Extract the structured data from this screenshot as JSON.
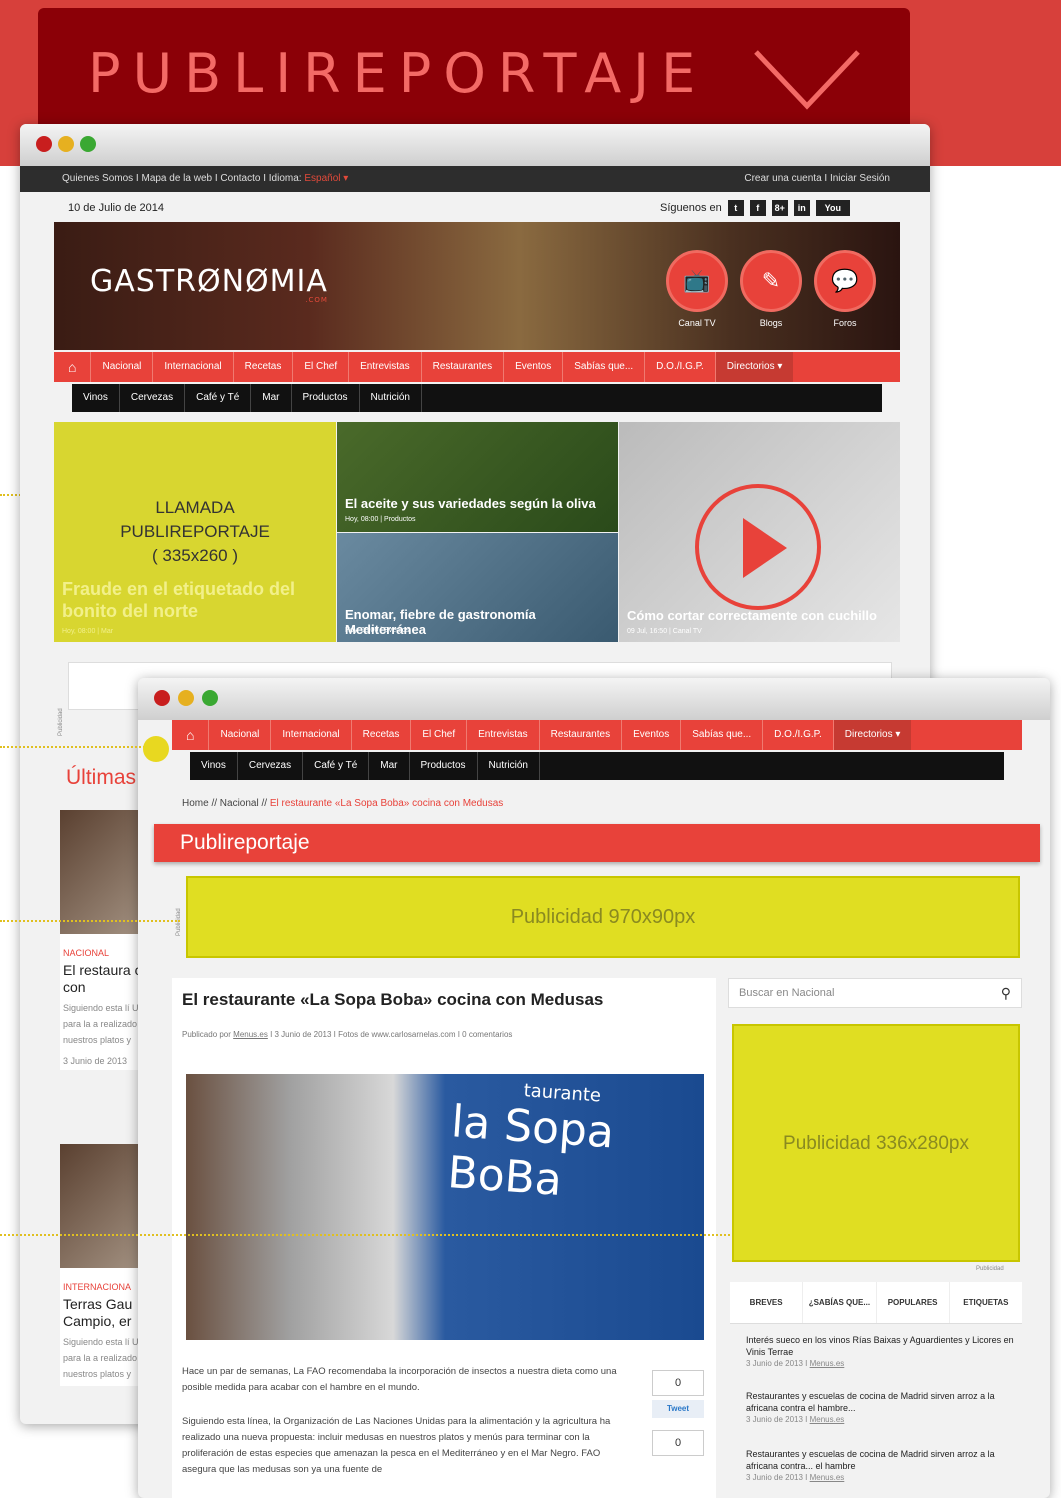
{
  "banner": {
    "title": "PUBLIREPORTAJE"
  },
  "top": {
    "left_links": "Quienes Somos   I   Mapa de la web   I   Contacto   I   Idioma:",
    "lang": "Español ▾",
    "right_links": "Crear una cuenta   I   Iniciar Sesión"
  },
  "date": "10 de Julio de 2014",
  "follow": "Síguenos en",
  "social": [
    "t",
    "f",
    "8+",
    "in",
    "You"
  ],
  "logo": "GASTRØNØMIA",
  "logo_com": ".COM",
  "circles": [
    "Canal TV",
    "Blogs",
    "Foros"
  ],
  "nav": [
    "Nacional",
    "Internacional",
    "Recetas",
    "El Chef",
    "Entrevistas",
    "Restaurantes",
    "Eventos",
    "Sabías que...",
    "D.O./I.G.P.",
    "Directorios ▾"
  ],
  "subnav": [
    "Vinos",
    "Cervezas",
    "Café y Té",
    "Mar",
    "Productos",
    "Nutrición"
  ],
  "tiles": {
    "call": "LLAMADA\nPUBLIREPORTAJE\n( 335x260 )",
    "t1_title": "Fraude en el etiquetado del bonito del norte",
    "t1_meta": "Hoy, 08:00 | Mar",
    "t2_title": "El aceite y sus variedades según la oliva",
    "t2_meta": "Hoy, 08:00 | Productos",
    "t3_title": "Enomar, fiebre de gastronomía Mediterránea",
    "t3_meta": "Hoy, 08:00 | Eventos",
    "t4_title": "Cómo cortar correctamente con cuchillo",
    "t4_meta": "09 Jul, 16:50 | Canal TV"
  },
  "ad_label": "Publicidad",
  "ultimas": "Últimas",
  "cards": [
    {
      "cat": "NACIONAL",
      "head": "El restaura cocina con",
      "text": "Siguiendo esta lí Unidas para la a realizado una nu nuestros platos y",
      "date": "3 Junio de 2013"
    },
    {
      "cat": "INTERNACIONA",
      "head": "Terras Gau Campio, er",
      "text": "Siguiendo esta lí Unidas para la a realizado una nu nuestros platos y",
      "date": ""
    }
  ],
  "breadcrumb": {
    "a": "Home  //  Nacional  //  ",
    "cur": "El restaurante «La Sopa Boba» cocina con Medusas"
  },
  "section": "Publireportaje",
  "ad970": "Publicidad 970x90px",
  "article": {
    "title": "El restaurante «La Sopa Boba» cocina con Medusas",
    "meta_a": "Publicado por ",
    "meta_user": "Menus.es",
    "meta_b": "   I   3 Junio de 2013   I   Fotos de www.carlosarnelas.com   I   0 comentarios",
    "sign": "la Sopa BoBa",
    "sign_top": "taurante",
    "p1": "Hace un par de semanas, La FAO recomendaba la incorporación de insectos a nuestra dieta como una posible medida para acabar con el hambre en el mundo.",
    "p2": "Siguiendo esta línea, la Organización de Las Naciones Unidas para la alimentación y la agricultura ha realizado una nueva propuesta: incluir medusas en nuestros platos y menús para terminar con la proliferación de estas especies que amenazan la pesca en el Mediterráneo y en el Mar Negro. FAO asegura que las medusas son ya una fuente de",
    "count1": "0",
    "tweet": "Tweet",
    "count2": "0"
  },
  "search": {
    "placeholder": "Buscar en Nacional"
  },
  "ad336": "Publicidad 336x280px",
  "tabs": [
    "BREVES",
    "¿SABÍAS QUE...",
    "POPULARES",
    "ETIQUETAS"
  ],
  "breves": [
    {
      "t": "Interés sueco en los vinos Rías Baixas y Aguardientes y Licores en Vinis Terrae",
      "d": "3 Junio de 2013  I  ",
      "u": "Menus.es"
    },
    {
      "t": "Restaurantes y escuelas de cocina de Madrid sirven arroz a la africana contra el hambre...",
      "d": "3 Junio de 2013  I  ",
      "u": "Menus.es"
    },
    {
      "t": "Restaurantes y escuelas de cocina de Madrid sirven arroz a la africana contra... el hambre",
      "d": "3 Junio de 2013  I  ",
      "u": "Menus.es"
    }
  ]
}
